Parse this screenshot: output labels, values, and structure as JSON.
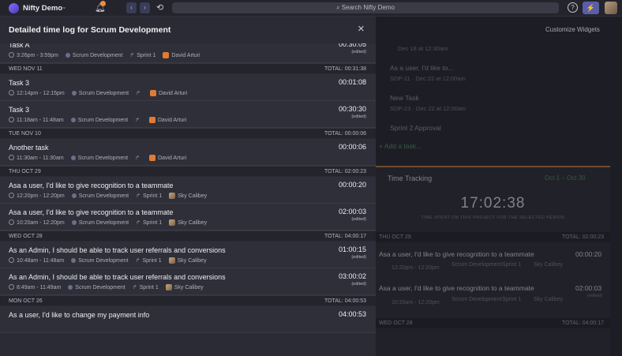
{
  "topbar": {
    "app_name": "Nifty Demo",
    "search_placeholder": "Search Nifty Demo",
    "help_glyph": "?",
    "bolt_glyph": "⚡"
  },
  "background": {
    "customize_label": "Customize Widgets",
    "tasks": [
      {
        "title": "",
        "sub": "Dec 18 at 12:30am"
      },
      {
        "title": "As a user, I'd like to...",
        "sub": "SDP-11 · Dec 22 at 12:00am"
      },
      {
        "title": "New Task",
        "sub": "SDP-23 · Dec 22 at 12:00am"
      },
      {
        "title": "Sprint 2 Approval",
        "sub": ""
      }
    ],
    "add_task_label": "+ Add a task...",
    "time_tracking": {
      "title": "Time Tracking",
      "range": "Oct 1 – Oct 30",
      "total_time": "17:02:38",
      "caption": "TIME SPENT ON THIS PROJECT FOR THE SELECTED PERIOD",
      "day1_label": "THU OCT 29",
      "day1_total": "TOTAL: 02:00:23",
      "row1_title": "Asa a user, I'd like to give recognition to a teammate",
      "row1_dur": "00:00:20",
      "row1_time": "12:20pm - 12:20pm",
      "row1_project": "Scrum Development",
      "row1_sprint": "Sprint 1",
      "row1_user": "Sky Calibey",
      "row2_title": "Asa a user, I'd like to give recognition to a teammate",
      "row2_dur": "02:00:03",
      "row2_edited": "(edited)",
      "row2_time": "10:20am - 12:20pm",
      "row2_project": "Scrum Development",
      "row2_sprint": "Sprint 1",
      "row2_user": "Sky Calibey",
      "day2_label": "WED OCT 28",
      "day2_total": "TOTAL: 04:00:17"
    }
  },
  "modal": {
    "title": "Detailed time log for Scrum Development",
    "close_glyph": "×",
    "edited_label": "(edited)",
    "first_entry": {
      "title": "Task A",
      "time": "3:26pm - 3:59pm",
      "project": "Scrum Development",
      "sprint": "Sprint 1",
      "user": "David Arturi",
      "duration": "00:30:05",
      "edited": true
    },
    "days": [
      {
        "label": "WED NOV 11",
        "total": "TOTAL: 00:31:38",
        "entries": [
          {
            "title": "Task 3",
            "time": "12:14pm - 12:15pm",
            "project": "Scrum Development",
            "sprint": "",
            "user": "David Arturi",
            "duration": "00:01:08",
            "edited": false
          },
          {
            "title": "Task 3",
            "time": "11:18am - 11:48am",
            "project": "Scrum Development",
            "sprint": "",
            "user": "David Arturi",
            "duration": "00:30:30",
            "edited": true
          }
        ]
      },
      {
        "label": "TUE NOV 10",
        "total": "TOTAL: 00:00:06",
        "entries": [
          {
            "title": "Another task",
            "time": "11:30am - 11:30am",
            "project": "Scrum Development",
            "sprint": "",
            "user": "David Arturi",
            "duration": "00:00:06",
            "edited": false
          }
        ]
      },
      {
        "label": "THU OCT 29",
        "total": "TOTAL: 02:00:23",
        "entries": [
          {
            "title": "Asa a user, I'd like to give recognition to a teammate",
            "time": "12:20pm - 12:20pm",
            "project": "Scrum Development",
            "sprint": "Sprint 1",
            "user": "Sky Calibey",
            "duration": "00:00:20",
            "edited": false
          },
          {
            "title": "Asa a user, I'd like to give recognition to a teammate",
            "time": "10:20am - 12:20pm",
            "project": "Scrum Development",
            "sprint": "Sprint 1",
            "user": "Sky Calibey",
            "duration": "02:00:03",
            "edited": true
          }
        ]
      },
      {
        "label": "WED OCT 28",
        "total": "TOTAL: 04:00:17",
        "entries": [
          {
            "title": "As an Admin, I should be able to track user referrals and conversions",
            "time": "10:48am - 11:48am",
            "project": "Scrum Development",
            "sprint": "Sprint 1",
            "user": "Sky Calibey",
            "duration": "01:00:15",
            "edited": true
          },
          {
            "title": "As an Admin, I should be able to track user referrals and conversions",
            "time": "8:49am - 11:49am",
            "project": "Scrum Development",
            "sprint": "Sprint 1",
            "user": "Sky Calibey",
            "duration": "03:00:02",
            "edited": true
          }
        ]
      },
      {
        "label": "MON OCT 26",
        "total": "TOTAL: 04:00:53",
        "entries": [
          {
            "title": "As a user, I'd like to change my payment info",
            "time": "",
            "project": "",
            "sprint": "",
            "user": "",
            "duration": "04:00:53",
            "edited": false
          }
        ]
      }
    ]
  }
}
